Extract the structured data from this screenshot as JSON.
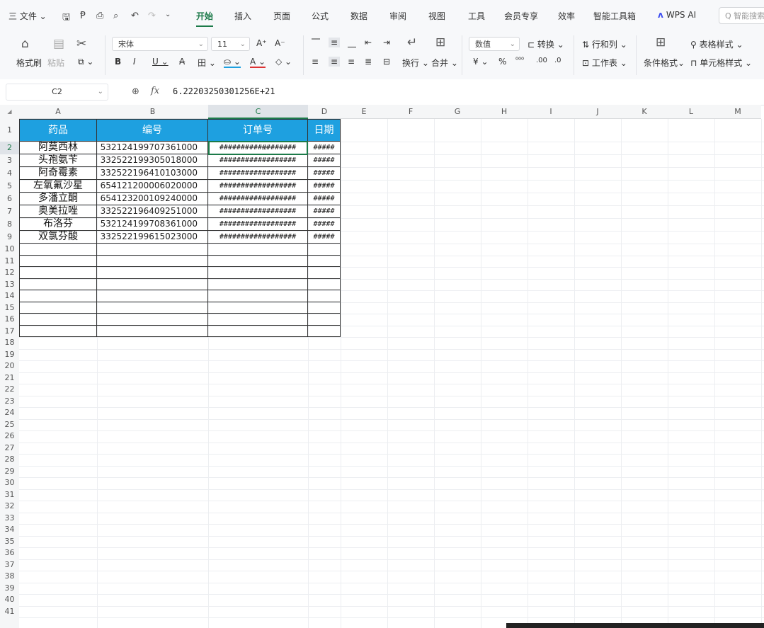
{
  "menu": {
    "file_label": "三 文件 ⌄",
    "tabs": [
      "开始",
      "插入",
      "页面",
      "公式",
      "数据",
      "审阅",
      "视图",
      "工具",
      "会员专享",
      "效率",
      "智能工具箱"
    ],
    "active_tab": "开始",
    "wps_ai": "WPS AI",
    "search_placeholder": "Q 智能搜索"
  },
  "ribbon": {
    "format_painter": "格式刷",
    "paste": "粘贴",
    "font_name": "宋体",
    "font_size": "11",
    "wrap": "换行",
    "merge": "合并",
    "number_format": "数值",
    "convert": "转换",
    "row_col": "行和列",
    "worksheet": "工作表",
    "cond_format": "条件格式",
    "table_style": "表格样式",
    "cell_style": "单元格样式"
  },
  "formula_bar": {
    "cell_ref": "C2",
    "formula": "6.22203250301256E+21"
  },
  "columns": [
    "A",
    "B",
    "C",
    "D",
    "E",
    "F",
    "G",
    "H",
    "I",
    "J",
    "K",
    "L",
    "M"
  ],
  "table": {
    "headers": [
      "药品",
      "编号",
      "订单号",
      "日期"
    ],
    "rows": [
      {
        "name": "阿莫西林",
        "code": "532124199707361000",
        "order": "##################",
        "date": "#####"
      },
      {
        "name": "头孢氨苄",
        "code": "332522199305018000",
        "order": "##################",
        "date": "#####"
      },
      {
        "name": "阿奇霉素",
        "code": "332522196410103000",
        "order": "##################",
        "date": "#####"
      },
      {
        "name": "左氧氟沙星",
        "code": "654121200006020000",
        "order": "##################",
        "date": "#####"
      },
      {
        "name": "多潘立酮",
        "code": "654123200109240000",
        "order": "##################",
        "date": "#####"
      },
      {
        "name": "奥美拉唑",
        "code": "332522196409251000",
        "order": "##################",
        "date": "#####"
      },
      {
        "name": "布洛芬",
        "code": "532124199708361000",
        "order": "##################",
        "date": "#####"
      },
      {
        "name": "双氯芬酸",
        "code": "332522199615023000",
        "order": "##################",
        "date": "#####"
      }
    ]
  },
  "row_numbers": [
    "1",
    "2",
    "3",
    "4",
    "5",
    "6",
    "7",
    "8",
    "9",
    "10",
    "11",
    "12",
    "13",
    "14",
    "15",
    "16",
    "17",
    "18",
    "19",
    "20",
    "21",
    "22",
    "23",
    "24",
    "25",
    "26",
    "27",
    "28",
    "29",
    "30",
    "31",
    "32",
    "33",
    "34",
    "35",
    "36",
    "37",
    "38",
    "39",
    "40",
    "41"
  ],
  "colors": {
    "accent": "#1c7a49",
    "header_fill": "#1ea0e0"
  }
}
